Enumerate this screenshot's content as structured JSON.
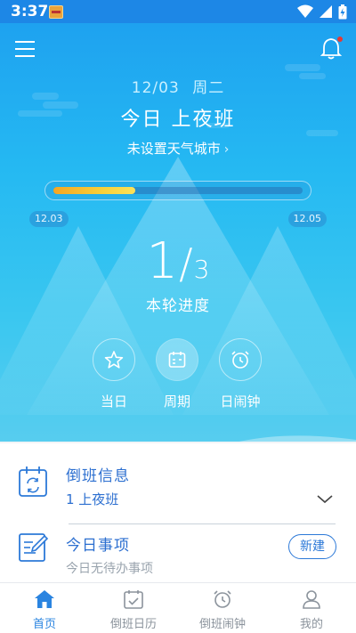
{
  "status_bar": {
    "time": "3:37"
  },
  "header": {
    "date": "12/03",
    "weekday": "周二",
    "shift_title": "今日 上夜班",
    "weather_link": "未设置天气城市",
    "cycle_progress": 0.33,
    "start_date": "12.03",
    "end_date": "12.05",
    "cycle_current": "1",
    "cycle_total": "3",
    "cycle_label": "本轮进度"
  },
  "modes": [
    {
      "label": "当日",
      "icon": "star-icon",
      "active": false
    },
    {
      "label": "周期",
      "icon": "calendar-icon",
      "active": true
    },
    {
      "label": "日闹钟",
      "icon": "alarm-clock-icon",
      "active": false
    }
  ],
  "cards": {
    "shift_info": {
      "title": "倒班信息",
      "value": "1 上夜班"
    },
    "today_items": {
      "title": "今日事项",
      "empty_text": "今日无待办事项",
      "new_button": "新建"
    }
  },
  "bottom_nav": [
    {
      "label": "首页",
      "icon": "home-icon",
      "active": true
    },
    {
      "label": "倒班日历",
      "icon": "calendar-check-icon",
      "active": false
    },
    {
      "label": "倒班闹钟",
      "icon": "alarm-clock-icon",
      "active": false
    },
    {
      "label": "我的",
      "icon": "user-icon",
      "active": false
    }
  ],
  "colors": {
    "accent": "#2a84e0",
    "hero_top": "#1ea2f0",
    "progress_fill": "#f9d03a",
    "badge": "#e53935"
  }
}
